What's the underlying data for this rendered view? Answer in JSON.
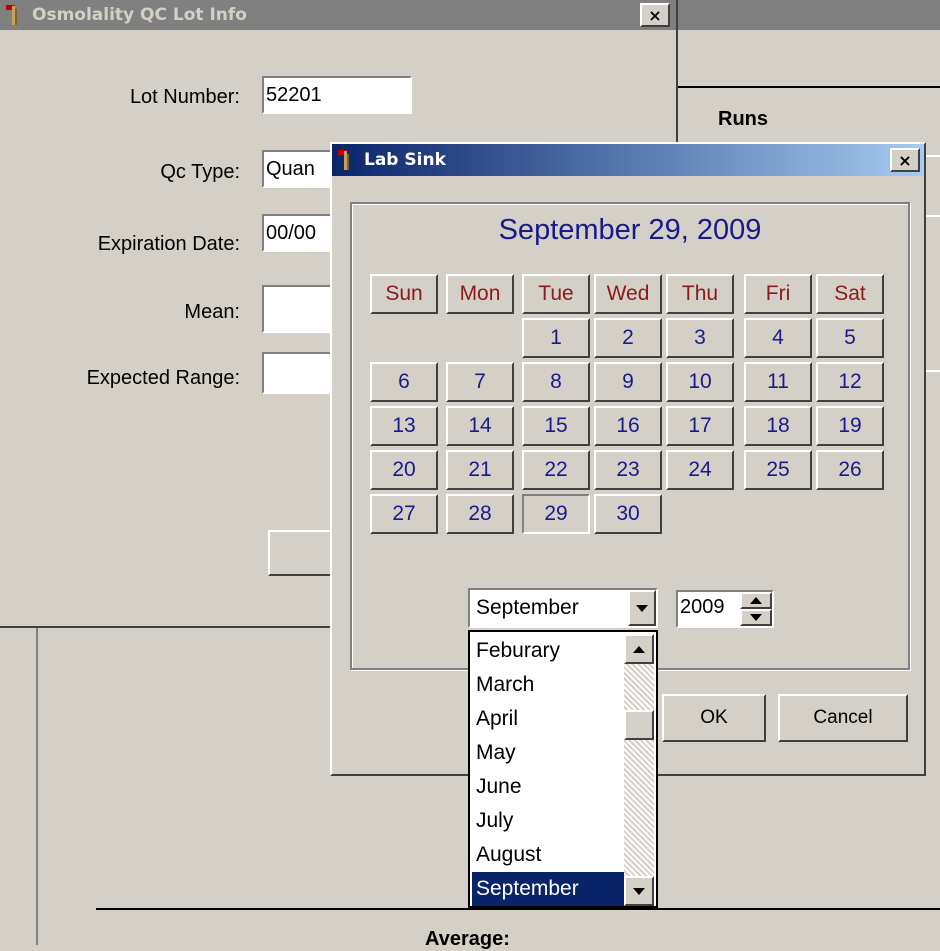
{
  "background": {
    "runs_label": "Runs",
    "average_label": "Average:"
  },
  "osmo_window": {
    "title": "Osmolality QC Lot Info",
    "close_glyph": "×",
    "fields": {
      "lot_number_label": "Lot Number:",
      "lot_number_value": "52201",
      "qc_type_label": "Qc Type:",
      "qc_type_value": "Quan",
      "expiration_label": "Expiration Date:",
      "expiration_value": "00/00",
      "mean_label": "Mean:",
      "mean_value": "",
      "range_label": "Expected Range:",
      "range_value": ""
    }
  },
  "lab_dialog": {
    "title": "Lab Sink",
    "close_glyph": "×",
    "heading": "September 29, 2009",
    "weekdays": [
      "Sun",
      "Mon",
      "Tue",
      "Wed",
      "Thu",
      "Fri",
      "Sat"
    ],
    "days": [
      "1",
      "2",
      "3",
      "4",
      "5",
      "6",
      "7",
      "8",
      "9",
      "10",
      "11",
      "12",
      "13",
      "14",
      "15",
      "16",
      "17",
      "18",
      "19",
      "20",
      "21",
      "22",
      "23",
      "24",
      "25",
      "26",
      "27",
      "28",
      "29",
      "30"
    ],
    "selected_day": "29",
    "month_value": "September",
    "year_value": "2009",
    "month_options": [
      "Feburary",
      "March",
      "April",
      "May",
      "June",
      "July",
      "August",
      "September"
    ],
    "ok_label": "OK",
    "cancel_label": "Cancel"
  },
  "colors": {
    "face": "#d4d0c8",
    "active_title_start": "#0a246a",
    "active_title_end": "#a6caf0",
    "weekday_text": "#8b1a1a",
    "day_text": "#1a1a8a",
    "selection": "#0a246a"
  },
  "icons": [
    "app-icon",
    "close-icon",
    "dropdown-arrow-icon",
    "spin-up-icon",
    "spin-down-icon",
    "scroll-up-icon",
    "scroll-down-icon"
  ]
}
